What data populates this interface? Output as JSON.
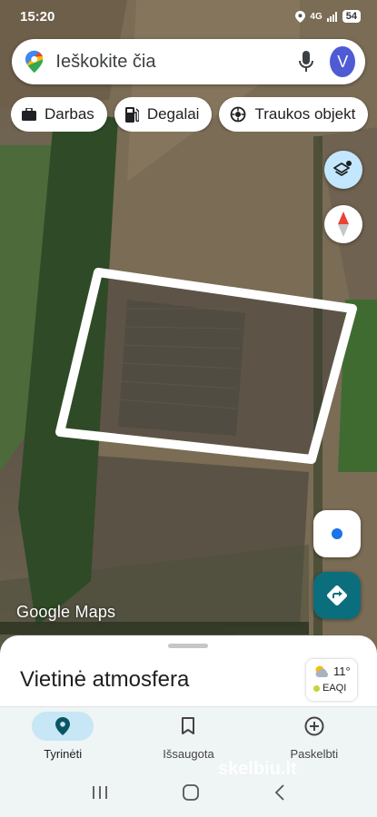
{
  "status_bar": {
    "time": "15:20",
    "network": "4G",
    "battery": "54"
  },
  "search": {
    "placeholder": "Ieškokite čia",
    "avatar_letter": "V"
  },
  "chips": [
    {
      "label": "Darbas",
      "icon": "briefcase-icon"
    },
    {
      "label": "Degalai",
      "icon": "fuel-icon"
    },
    {
      "label": "Traukos objekt",
      "icon": "camera-attraction-icon"
    }
  ],
  "map": {
    "watermark": "Google Maps"
  },
  "sheet": {
    "title": "Vietinė atmosfera"
  },
  "weather": {
    "temperature": "11°",
    "aq_label": "EAQI"
  },
  "bottom_nav": [
    {
      "label": "Tyrinėti",
      "icon": "explore-pin-icon",
      "active": true
    },
    {
      "label": "Išsaugota",
      "icon": "bookmark-icon",
      "active": false
    },
    {
      "label": "Paskelbti",
      "icon": "add-circle-icon",
      "active": false
    }
  ],
  "site_watermark": "skelbiu.lt",
  "colors": {
    "accent": "#0b6e7c",
    "active_nav": "#c7e6f6",
    "layers_button": "#c2e7ff"
  }
}
